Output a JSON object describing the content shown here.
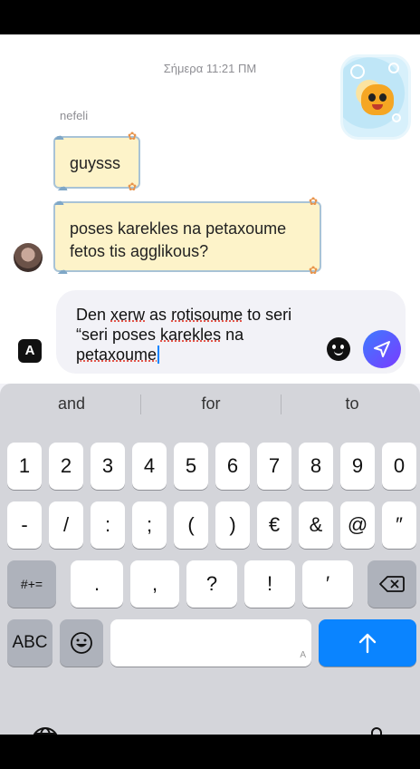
{
  "chat": {
    "timestamp": "Σήμερα 11:21 ΠΜ",
    "sender_name": "nefeli",
    "messages": [
      {
        "text": "guysss"
      },
      {
        "text": "poses karekles na petaxoume\nfetos tis agglikous?"
      }
    ]
  },
  "composer": {
    "app_icon_label": "A",
    "text_line1": "Den ",
    "text_xerw": "xerw",
    "text_mid1": " as ",
    "text_rotisoume": "rotisoume",
    "text_mid2": " to seri",
    "text_line2a": "“seri poses ",
    "text_karekles": "karekles",
    "text_line2b": " na",
    "text_petaxoume": "petaxoume"
  },
  "keyboard": {
    "predictions": [
      "and",
      "for",
      "to"
    ],
    "row1": [
      "1",
      "2",
      "3",
      "4",
      "5",
      "6",
      "7",
      "8",
      "9",
      "0"
    ],
    "row2": [
      "-",
      "/",
      ":",
      ";",
      "(",
      ")",
      "€",
      "&",
      "@",
      "″"
    ],
    "row3": [
      "#+=",
      ".",
      ",",
      "?",
      "!",
      "′"
    ],
    "abc_label": "ABC",
    "return_hint": "A"
  }
}
